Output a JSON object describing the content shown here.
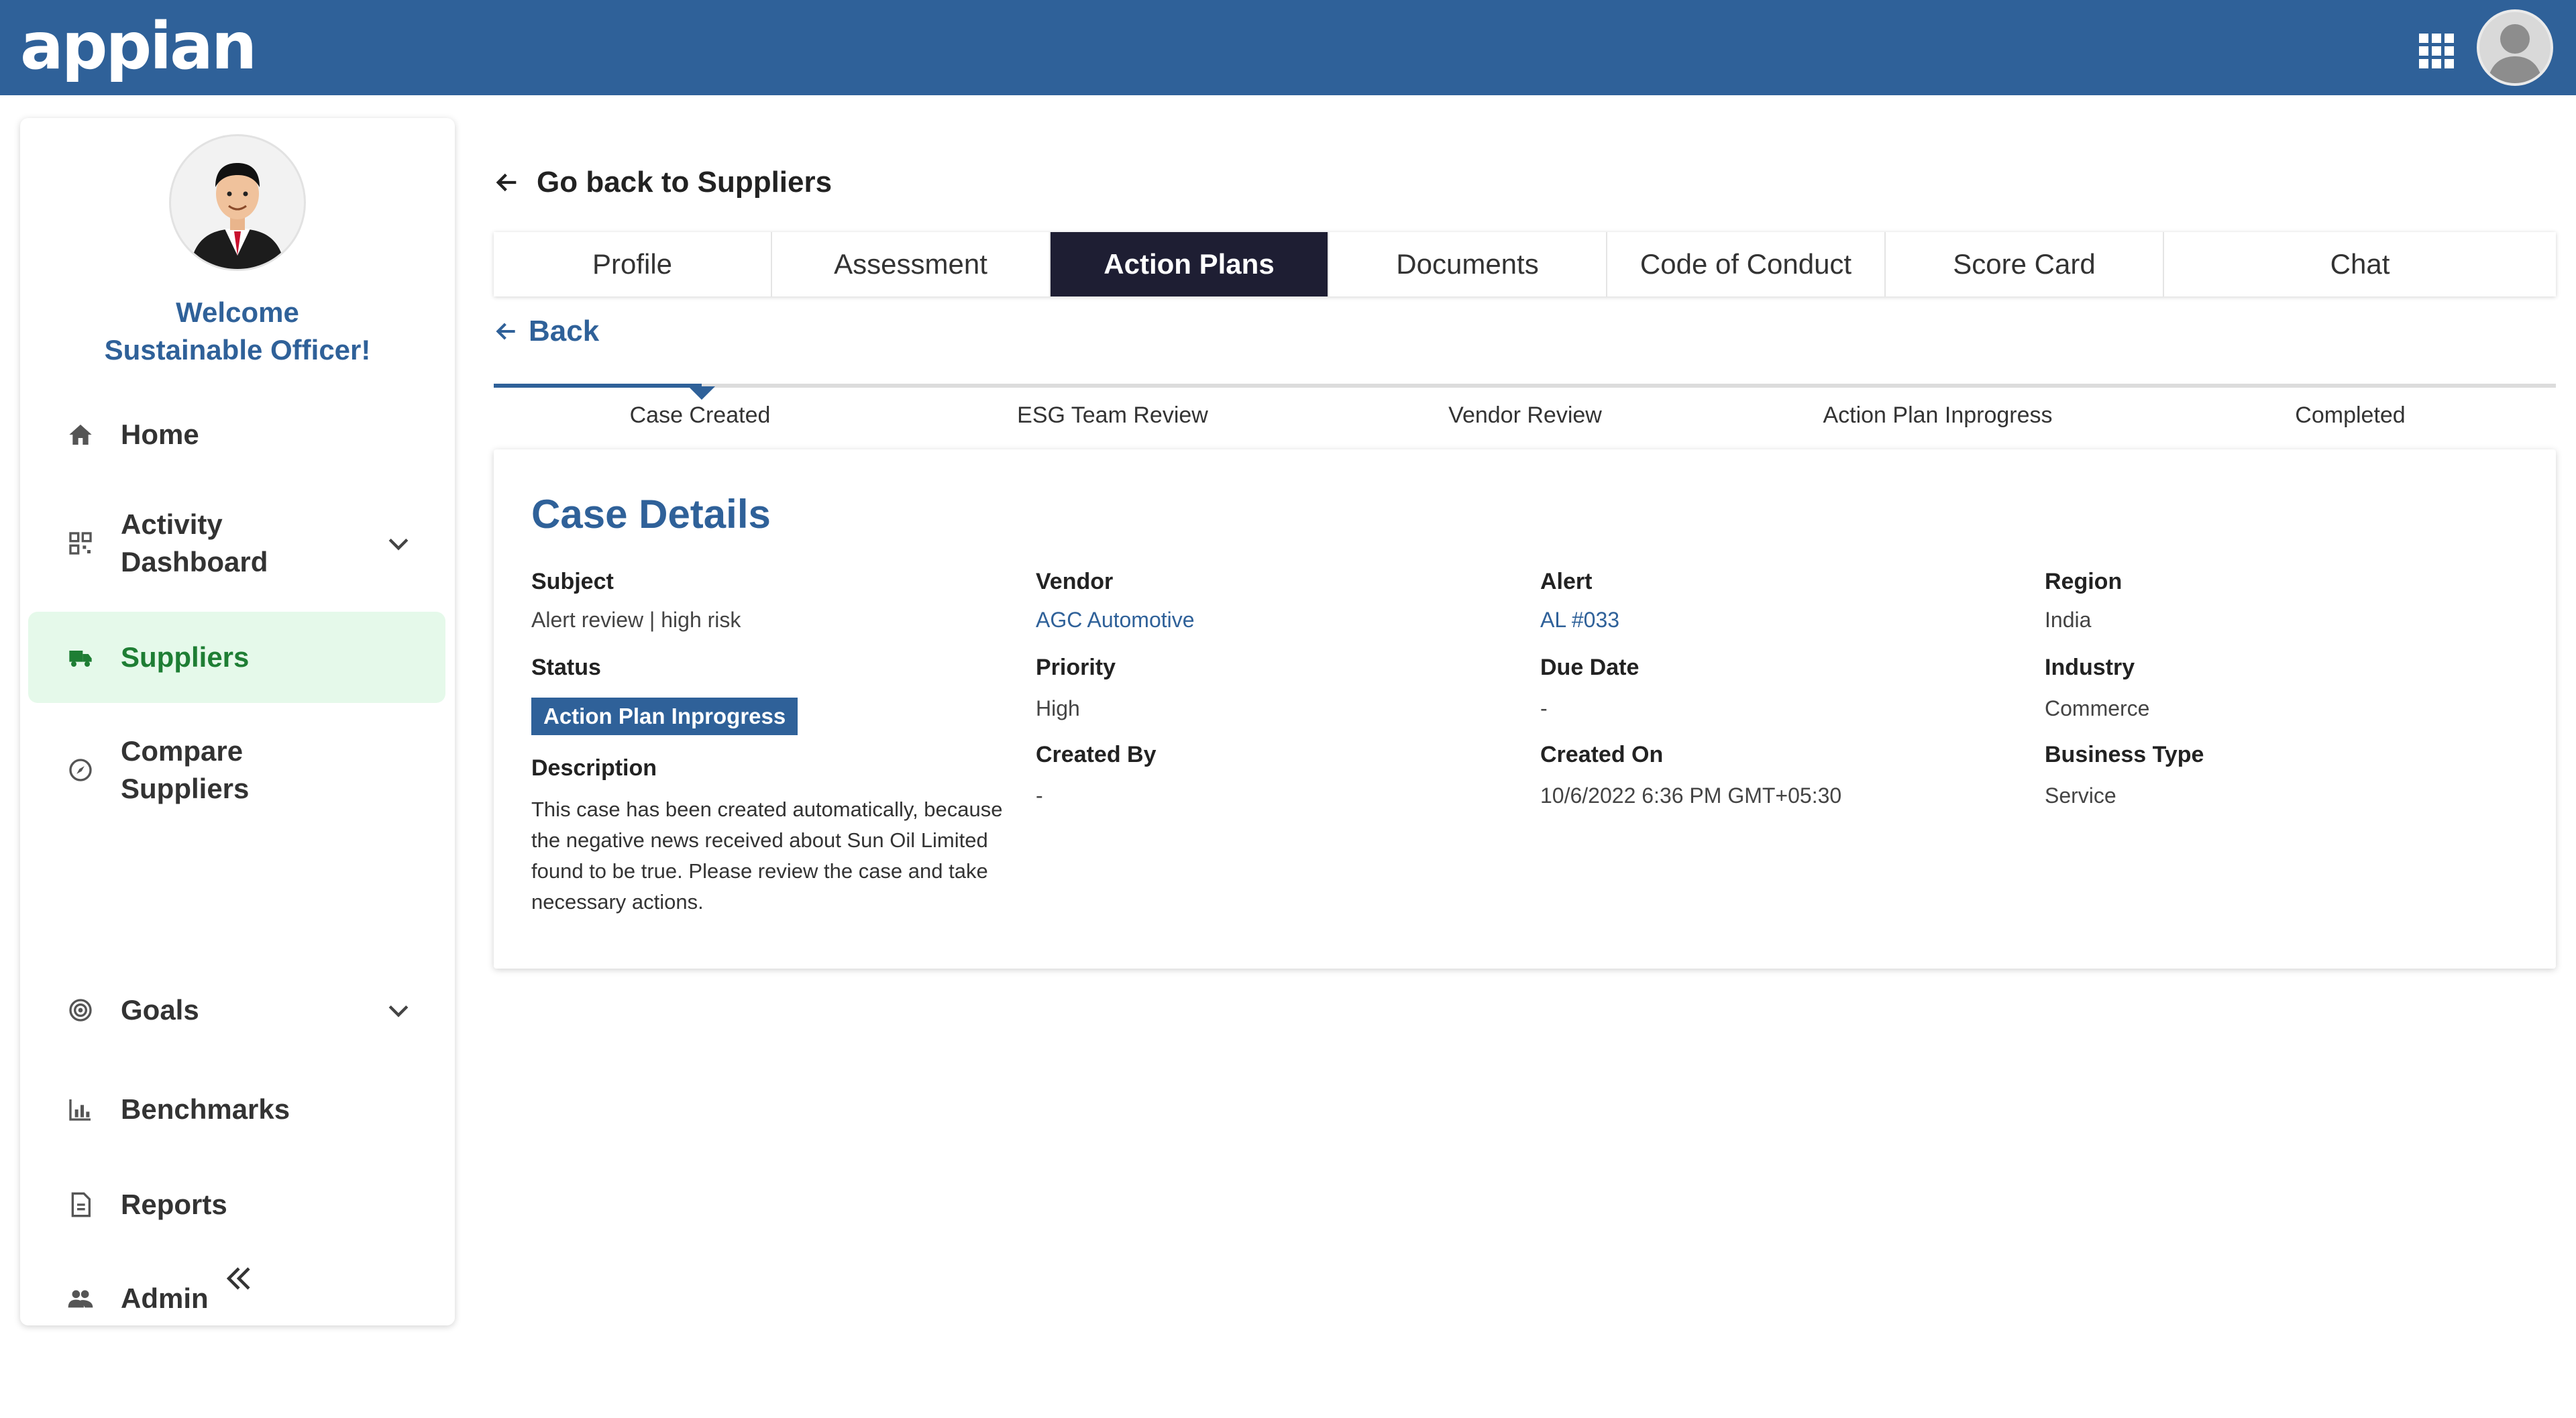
{
  "header": {
    "logo": "appian"
  },
  "sidebar": {
    "welcome_line1": "Welcome",
    "welcome_line2": "Sustainable Officer!",
    "items": [
      {
        "label": "Home",
        "icon": "home-icon"
      },
      {
        "label": "Activity Dashboard",
        "icon": "dashboard-icon",
        "expandable": true
      },
      {
        "label": "Suppliers",
        "icon": "truck-icon",
        "active": true
      },
      {
        "label": "Compare Suppliers",
        "icon": "compass-icon"
      },
      {
        "label": "Goals",
        "icon": "target-icon",
        "expandable": true
      },
      {
        "label": "Benchmarks",
        "icon": "bar-chart-icon"
      },
      {
        "label": "Reports",
        "icon": "report-icon"
      },
      {
        "label": "Admin",
        "icon": "admin-users-icon"
      }
    ],
    "collapse_label": "«"
  },
  "nav": {
    "go_back_label": "Go back to Suppliers",
    "back_label": "Back"
  },
  "tabs": [
    {
      "label": "Profile"
    },
    {
      "label": "Assessment"
    },
    {
      "label": "Action Plans",
      "active": true
    },
    {
      "label": "Documents"
    },
    {
      "label": "Code of Conduct"
    },
    {
      "label": "Score Card"
    },
    {
      "label": "Chat"
    }
  ],
  "stepper": {
    "steps": [
      "Case Created",
      "ESG Team Review",
      "Vendor Review",
      "Action Plan Inprogress",
      "Completed"
    ],
    "current": "Case Created"
  },
  "case": {
    "title": "Case Details",
    "subject_label": "Subject",
    "subject": "Alert review | high risk",
    "status_label": "Status",
    "status": "Action Plan Inprogress",
    "description_label": "Description",
    "description": "This case has been created automatically, because the negative news received about Sun Oil Limited found to be true. Please review the case and take necessary actions.",
    "vendor_label": "Vendor",
    "vendor": "AGC Automotive",
    "priority_label": "Priority",
    "priority": "High",
    "created_by_label": "Created By",
    "created_by": "-",
    "alert_label": "Alert",
    "alert": "AL #033",
    "due_date_label": "Due Date",
    "due_date": "-",
    "created_on_label": "Created On",
    "created_on": "10/6/2022 6:36 PM GMT+05:30",
    "region_label": "Region",
    "region": "India",
    "industry_label": "Industry",
    "industry": "Commerce",
    "business_type_label": "Business Type",
    "business_type": "Service"
  },
  "colors": {
    "brand": "#2f6199",
    "active_tab": "#1e1e33",
    "active_nav_bg": "#e5f9ea",
    "active_nav_text": "#1e7e34"
  }
}
